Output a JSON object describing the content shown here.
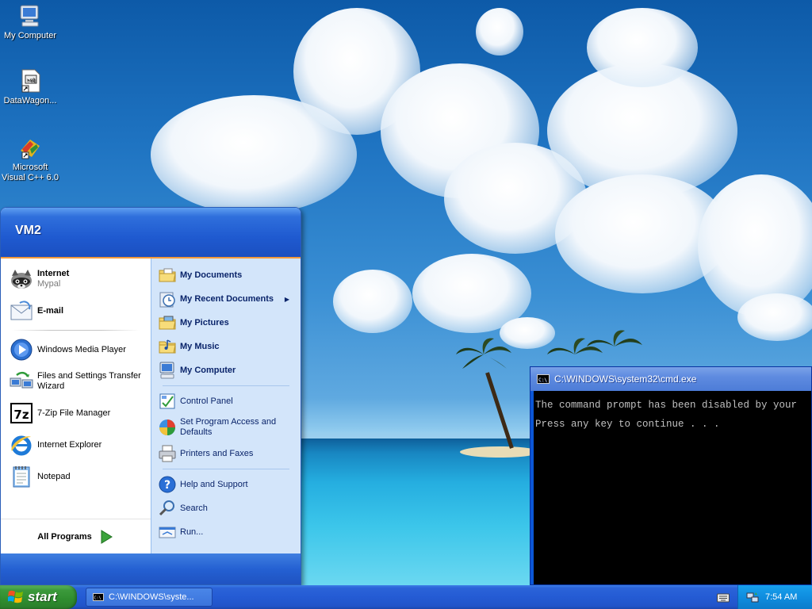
{
  "desktop": {
    "icons": [
      {
        "name": "my-computer",
        "label": "My Computer",
        "icon": "computer-icon"
      },
      {
        "name": "datawagon",
        "label": "DataWagon...",
        "icon": "shortcut-file-icon"
      },
      {
        "name": "visual-cpp",
        "label": "Microsoft Visual C++ 6.0",
        "icon": "visual-studio-icon"
      }
    ]
  },
  "start_menu": {
    "user": "VM2",
    "pinned": [
      {
        "label": "Internet",
        "sub": "Mypal",
        "icon": "mypal-raccoon-icon"
      },
      {
        "label": "E-mail",
        "icon": "email-icon"
      }
    ],
    "recent": [
      {
        "label": "Windows Media Player",
        "icon": "media-player-icon"
      },
      {
        "label": "Files and Settings Transfer Wizard",
        "icon": "transfer-wizard-icon"
      },
      {
        "label": "7-Zip File Manager",
        "icon": "7zip-icon"
      },
      {
        "label": "Internet Explorer",
        "icon": "internet-explorer-icon"
      },
      {
        "label": "Notepad",
        "icon": "notepad-icon"
      }
    ],
    "all_programs": "All Programs",
    "places": [
      {
        "label": "My Documents",
        "icon": "folder-documents-icon"
      },
      {
        "label": "My Recent Documents",
        "icon": "recent-documents-icon"
      },
      {
        "label": "My Pictures",
        "icon": "folder-pictures-icon"
      },
      {
        "label": "My Music",
        "icon": "folder-music-icon"
      },
      {
        "label": "My Computer",
        "icon": "computer-icon"
      }
    ],
    "settings": [
      {
        "label": "Control Panel",
        "icon": "control-panel-icon"
      },
      {
        "label": "Set Program Access and Defaults",
        "icon": "program-defaults-icon"
      },
      {
        "label": "Printers and Faxes",
        "icon": "printer-icon"
      }
    ],
    "tools": [
      {
        "label": "Help and Support",
        "icon": "help-icon"
      },
      {
        "label": "Search",
        "icon": "search-icon"
      },
      {
        "label": "Run...",
        "icon": "run-icon"
      }
    ]
  },
  "cmd_window": {
    "title": "C:\\WINDOWS\\system32\\cmd.exe",
    "lines": [
      "The command prompt has been disabled by your",
      "Press any key to continue . . ."
    ]
  },
  "taskbar": {
    "start_label": "start",
    "task_label": "C:\\WINDOWS\\syste...",
    "clock": "7:54 AM"
  },
  "colors": {
    "taskbar_blue": "#245bd4",
    "start_green": "#3c9a3c",
    "start_menu_header": "#1f5ad0",
    "start_menu_right_pane": "#d3e5fa",
    "tray_blue": "#0f8ddf"
  }
}
